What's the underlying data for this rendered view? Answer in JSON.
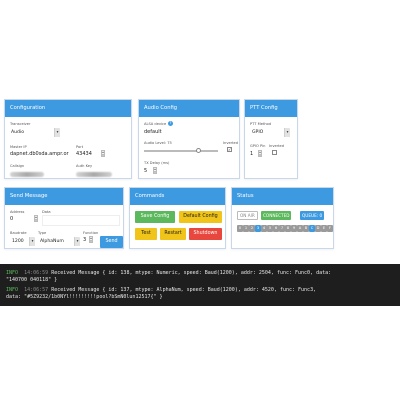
{
  "configuration": {
    "title": "Configuration",
    "transceiver_label": "Transceiver",
    "transceiver_value": "Audio",
    "master_ip_label": "Master IP",
    "master_ip_value": "dapnet.db0sda.ampr.or",
    "port_label": "Port",
    "port_value": "43434",
    "callsign_label": "Callsign",
    "auth_key_label": "Auth Key"
  },
  "audio_config": {
    "title": "Audio Config",
    "alsa_device_label": "ALSA device",
    "alsa_device_value": "default",
    "audio_level_label": "Audio Level: 75",
    "audio_level": 75,
    "inverted_label": "Inverted",
    "inverted_checked": true,
    "tx_delay_label": "TX Delay (ms)",
    "tx_delay_value": "5"
  },
  "ptt_config": {
    "title": "PTT Config",
    "ptt_method_label": "PTT Method",
    "ptt_method_value": "GPIO",
    "gpio_pin_label": "GPIO Pin",
    "gpio_pin_value": "1",
    "inverted_label": "Inverted",
    "inverted_checked": false
  },
  "send_message": {
    "title": "Send Message",
    "address_label": "Address",
    "address_value": "0",
    "data_label": "Data",
    "baudrate_label": "Baudrate",
    "baudrate_value": "1200",
    "type_label": "Type",
    "type_value": "AlphaNum",
    "function_label": "Function",
    "function_value": "3",
    "send_label": "Send"
  },
  "commands": {
    "title": "Commands",
    "save_config": "Save Config",
    "default_config": "Default Config",
    "test": "Test",
    "restart": "Restart",
    "shutdown": "Shutdown"
  },
  "status": {
    "title": "Status",
    "on_air": "ON AIR",
    "connected": "CONNECTED",
    "queue": "QUEUE: 0",
    "slots": [
      "0",
      "1",
      "2",
      "3",
      "4",
      "5",
      "6",
      "7",
      "8",
      "9",
      "A",
      "B",
      "C",
      "D",
      "E",
      "F"
    ],
    "active_slots": [
      "3",
      "C"
    ]
  },
  "console": {
    "lines": [
      {
        "level": "INFO",
        "time": "14:06:59",
        "message": "Received Message { id: 138, mtype: Numeric, speed: Baud(1200), addr: 2504, func: Func0, data:",
        "cont": "\"140700 040118\" }"
      },
      {
        "level": "INFO",
        "time": "14:06:57",
        "message": "Received Message { id: 137, mtype: AlphaNum, speed: Baud(1200), addr: 4520, func: Func3,",
        "cont": "data: \"#5Z9232/1b0NYl!!!!!!!!!pool?bSmN0lun12517{\" }"
      }
    ]
  },
  "colors": {
    "accent": "#3d9ae0",
    "success": "#5cb85c",
    "warning": "#f0c419",
    "danger": "#e7473c"
  }
}
